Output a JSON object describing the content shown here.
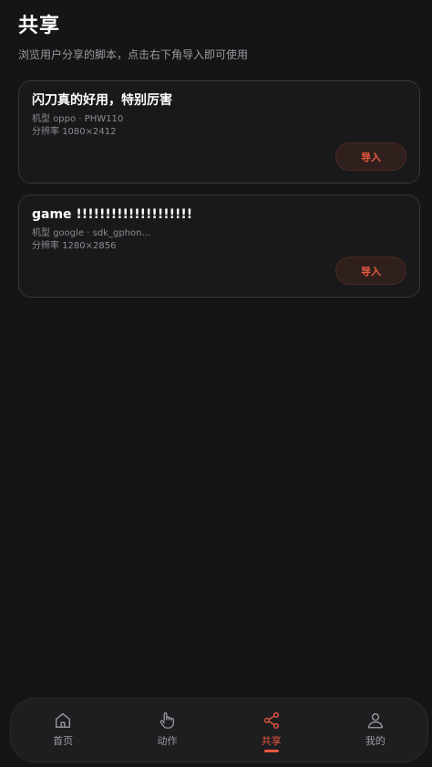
{
  "header": {
    "title": "共享",
    "subtitle": "浏览用户分享的脚本，点击右下角导入即可使用"
  },
  "cards": [
    {
      "title": "闪刀真的好用，特别厉害",
      "model_label": "机型",
      "brand": "oppo",
      "separator": "·",
      "model": "PHW110",
      "resolution_label": "分辨率",
      "resolution": "1080×2412",
      "import_label": "导入"
    },
    {
      "title": "game !!!!!!!!!!!!!!!!!!!!",
      "model_label": "机型",
      "brand": "google",
      "separator": "·",
      "model": "sdk_gphon...",
      "resolution_label": "分辨率",
      "resolution": "1280×2856",
      "import_label": "导入"
    }
  ],
  "tabbar": {
    "tabs": [
      {
        "label": "首页",
        "icon": "home-icon"
      },
      {
        "label": "动作",
        "icon": "hand-pointer-icon"
      },
      {
        "label": "共享",
        "icon": "share-icon",
        "active": true
      },
      {
        "label": "我的",
        "icon": "user-icon"
      }
    ]
  },
  "colors": {
    "background": "#151416",
    "accent": "#e9573f",
    "card_border": "#39373b",
    "muted_text": "#9a9a9e"
  }
}
